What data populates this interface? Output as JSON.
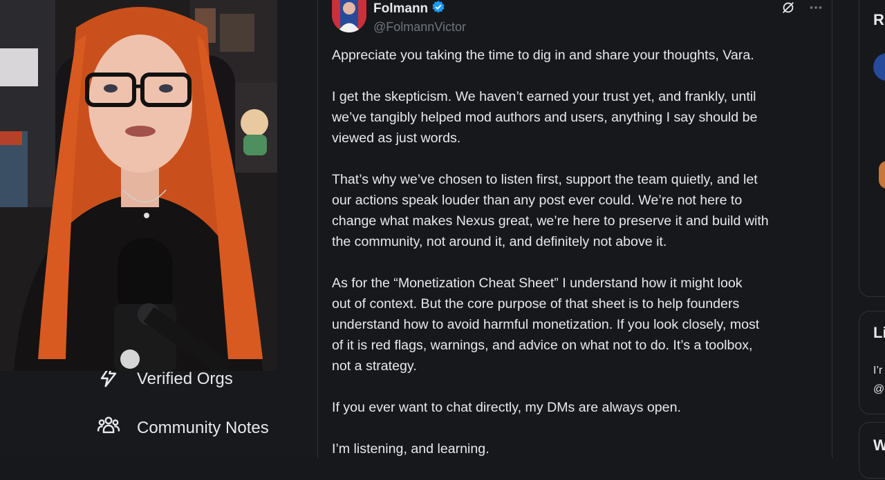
{
  "nav": {
    "items": [
      {
        "label": "Verified Orgs",
        "icon": "lightning-icon"
      },
      {
        "label": "Community Notes",
        "icon": "people-icon"
      }
    ]
  },
  "tweet": {
    "author": {
      "display_name": "Folmann",
      "handle": "@FolmannVictor",
      "verified_color": "#1d9bf0"
    },
    "paragraphs": [
      "Appreciate you taking the time to dig in and share your thoughts, Vara.",
      "I get the skepticism. We haven’t earned your trust yet, and frankly, until\nwe’ve tangibly helped mod authors and users, anything I say should be\nviewed as just words.",
      "That’s why we’ve chosen to listen first, support the team quietly, and let\nour actions speak louder than any post ever could. We’re not here to\nchange what makes Nexus great, we’re here to preserve it and build with\nthe community, not around it, and definitely not above it.",
      "As for the “Monetization Cheat Sheet” I understand how it might look\nout of context. But the core purpose of that sheet is to help founders\nunderstand how to avoid harmful monetization. If you look closely, most\nof it is red flags, warnings, and advice on what not to do. It’s a toolbox,\nnot a strategy.",
      "If you ever want to chat directly, my DMs are always open.",
      "I’m listening, and learning."
    ]
  },
  "rightcol": {
    "card1_title": "R",
    "card2_title": "Li",
    "card2_line1": "I’r",
    "card2_line2": "@",
    "card3_title": "W"
  },
  "colors": {
    "background": "#16181c",
    "text": "#e7e9ea",
    "muted": "#71767b",
    "border": "#2f3336",
    "hair": "#d4561e"
  }
}
